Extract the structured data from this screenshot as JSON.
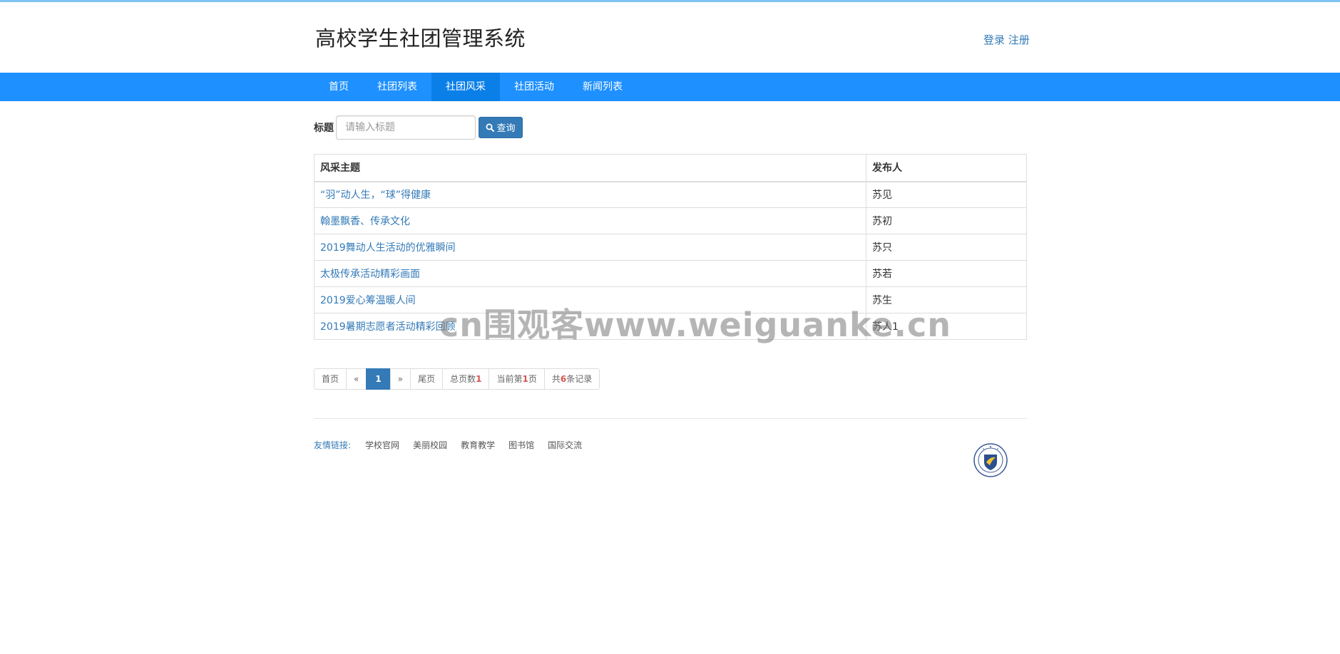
{
  "header": {
    "title": "高校学生社团管理系统",
    "login_label": "登录",
    "register_label": "注册"
  },
  "nav": {
    "items": [
      {
        "label": "首页",
        "active": false
      },
      {
        "label": "社团列表",
        "active": false
      },
      {
        "label": "社团风采",
        "active": true
      },
      {
        "label": "社团活动",
        "active": false
      },
      {
        "label": "新闻列表",
        "active": false
      }
    ]
  },
  "search": {
    "label": "标题",
    "placeholder": "请输入标题",
    "value": "",
    "button_label": "查询",
    "button_icon": "search-icon"
  },
  "table": {
    "headers": [
      "风采主题",
      "发布人"
    ],
    "rows": [
      {
        "title": "“羽”动人生，“球”得健康",
        "publisher": "苏见"
      },
      {
        "title": "翰墨飘香、传承文化",
        "publisher": "苏初"
      },
      {
        "title": "2019舞动人生活动的优雅瞬间",
        "publisher": "苏只"
      },
      {
        "title": "太极传承活动精彩画面",
        "publisher": "苏若"
      },
      {
        "title": "2019爱心筹温暖人间",
        "publisher": "苏生"
      },
      {
        "title": "2019暑期志愿者活动精彩回顾",
        "publisher": "苏人1"
      }
    ]
  },
  "pager": {
    "first_label": "首页",
    "prev_label": "«",
    "current_page": "1",
    "next_label": "»",
    "last_label": "尾页",
    "total_pages_prefix": "总页数",
    "total_pages": "1",
    "current_prefix": "当前第",
    "current_value": "1",
    "current_suffix": "页",
    "records_prefix": "共",
    "records_count": "6",
    "records_suffix": "条记录"
  },
  "footer": {
    "links_label": "友情链接:",
    "links": [
      "学校官网",
      "美丽校园",
      "教育教学",
      "图书馆",
      "国际交流"
    ]
  },
  "watermark": "cn围观客www.weiguanke.cn",
  "colors": {
    "nav_bg": "#1e90ff",
    "nav_active": "#0a7fe8",
    "link": "#337ab7",
    "button": "#337ab7",
    "highlight_number": "#d9534f"
  }
}
